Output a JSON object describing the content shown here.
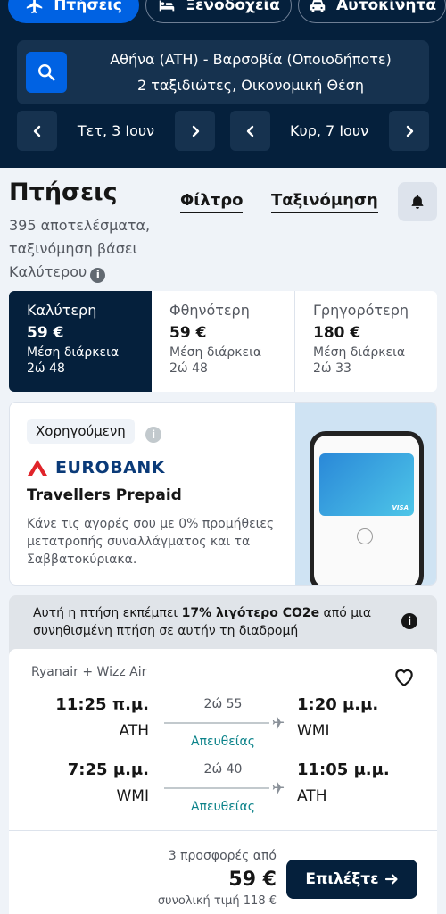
{
  "header": {
    "tabs": [
      {
        "label": "Πτήσεις",
        "icon": "plane-icon",
        "active": true
      },
      {
        "label": "Ξενοδοχεία",
        "icon": "bed-icon",
        "active": false
      },
      {
        "label": "Αυτοκίνητα",
        "icon": "car-icon",
        "active": false
      }
    ],
    "search": {
      "route": "Αθήνα (ATH) - Βαρσοβία (Οποιοδήποτε)",
      "details": "2 ταξιδιώτες, Οικονομική Θέση"
    },
    "depart_date": "Τετ, 3 Ιουν",
    "return_date": "Κυρ, 7 Ιουν"
  },
  "results": {
    "title": "Πτήσεις",
    "summary": "395 αποτελέσματα, ταξινόμηση βάσει Καλύτερου",
    "filter_label": "Φίλτρο",
    "sort_label": "Ταξινόμηση"
  },
  "sort_options": [
    {
      "label": "Καλύτερη",
      "price": "59 €",
      "sub": "Μέση διάρκεια",
      "duration": "2ώ 48",
      "active": true
    },
    {
      "label": "Φθηνότερη",
      "price": "59 €",
      "sub": "Μέση διάρκεια",
      "duration": "2ώ 48",
      "active": false
    },
    {
      "label": "Γρηγορότερη",
      "price": "180 €",
      "sub": "Μέση διάρκεια",
      "duration": "2ώ 33",
      "active": false
    }
  ],
  "ad": {
    "sponsored_label": "Χορηγούμενη",
    "brand": "EUROBANK",
    "title": "Travellers Prepaid",
    "description": "Κάνε τις αγορές σου με 0% προμήθειες μετατροπής συναλλάγματος και τα Σαββατοκύριακα."
  },
  "eco": {
    "text_before": "Αυτή η πτήση εκπέμπει ",
    "highlight": "17% λιγότερο CO2e",
    "text_after": " από μια συνηθισμένη πτήση σε αυτήν τη διαδρομή"
  },
  "flight": {
    "airlines": "Ryanair + Wizz Air",
    "legs": [
      {
        "dep_time": "11:25 π.μ.",
        "dep_code": "ATH",
        "duration": "2ώ 55",
        "stops": "Απευθείας",
        "arr_time": "1:20 μ.μ.",
        "arr_code": "WMI"
      },
      {
        "dep_time": "7:25 μ.μ.",
        "dep_code": "WMI",
        "duration": "2ώ 40",
        "stops": "Απευθείας",
        "arr_time": "11:05 μ.μ.",
        "arr_code": "ATH"
      }
    ],
    "offers": "3 προσφορές από",
    "price": "59 €",
    "total": "συνολική τιμή 118 €",
    "select_label": "Επιλέξτε"
  },
  "colors": {
    "header_bg": "#05203c",
    "accent": "#0062e3",
    "direct": "#0c838a"
  }
}
